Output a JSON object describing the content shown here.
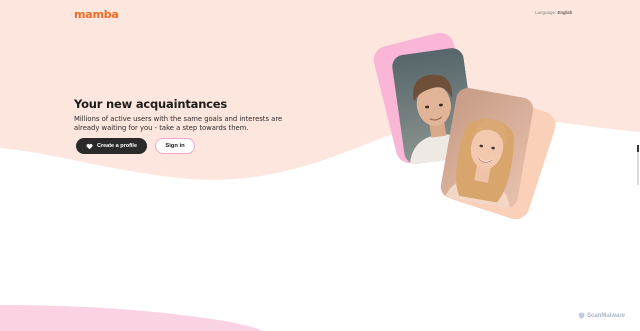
{
  "header": {
    "logo_text": "mamba",
    "language_label": "Language:",
    "language_value": "English"
  },
  "hero": {
    "title": "Your new acquaintances",
    "subtitle": "Millions of active users with the same goals and interests are already waiting for you - take a step towards them.",
    "create_profile_label": "Create a profile",
    "sign_in_label": "Sign in"
  },
  "watermark": {
    "text": "ScanMalware"
  },
  "colors": {
    "brand": "#f26a21",
    "hero_background": "#fde6dd",
    "pink_accent": "#f5a6c8",
    "peach_accent": "#f8c9b0",
    "button_dark": "#2a2a2a"
  },
  "icons": {
    "create_button": "heart-icon",
    "watermark": "shield-icon"
  }
}
